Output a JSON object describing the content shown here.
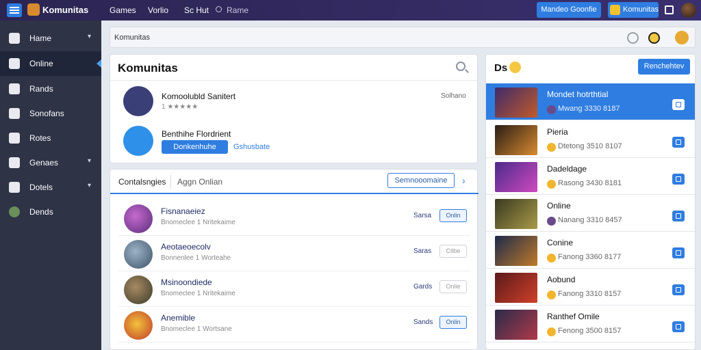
{
  "topbar": {
    "app_title": "Komunitas",
    "nav": [
      "Games",
      "Vorlio",
      "Sc Hut",
      "Rame"
    ],
    "btn_primary": "Mandeo Goonfie",
    "btn_notifications": "Komunitas",
    "icons": [
      "menu-icon",
      "logo-icon",
      "search-icon",
      "notification-icon",
      "grid-icon",
      "user-avatar"
    ]
  },
  "sidebar": {
    "items": [
      {
        "label": "Hame",
        "icon": "home-icon",
        "chevron": true
      },
      {
        "label": "Online",
        "icon": "pen-icon",
        "chevron": false,
        "active": true
      },
      {
        "label": "Rands",
        "icon": "book-icon",
        "chevron": false
      },
      {
        "label": "Sonofans",
        "icon": "chat-icon",
        "chevron": false
      },
      {
        "label": "Rotes",
        "icon": "user-icon",
        "chevron": false
      },
      {
        "label": "Genaes",
        "icon": "pencil-icon",
        "chevron": true
      },
      {
        "label": "Dotels",
        "icon": "building-icon",
        "chevron": true
      },
      {
        "label": "Dends",
        "icon": "avatar-icon",
        "chevron": false
      }
    ]
  },
  "search": {
    "value": "Komunitas"
  },
  "community": {
    "title": "Komunitas",
    "entries": [
      {
        "title": "Komoolubld Sanitert",
        "sub": "1 ★★★★★",
        "right": "Solhano"
      },
      {
        "title": "Benthihe Flordrient",
        "button": "Donkenhuhe",
        "link": "Gshusbate"
      }
    ]
  },
  "categories": {
    "tab1": "Contalsngies",
    "tab2": "Aggn Onlian",
    "button": "Semnooomaine",
    "rows": [
      {
        "title": "Fisnanaeiez",
        "sub": "Bnomeclee 1 Nritekaime",
        "status": "Sarsa",
        "button": "Onlin",
        "online": true
      },
      {
        "title": "Aeotaeoecolv",
        "sub": "Bonnenlee 1 Worteahe",
        "status": "Saras",
        "button": "Ctlbe",
        "online": false
      },
      {
        "title": "Msinoondiede",
        "sub": "Bnomeclee 1 Nritekaime",
        "status": "Gards",
        "button": "Onlie",
        "online": false
      },
      {
        "title": "Anemible",
        "sub": "Bnomeclee 1 Wortsane",
        "status": "Sands",
        "button": "Onlin",
        "online": true
      }
    ]
  },
  "games_panel": {
    "title": "Ds",
    "button": "Renchehtev",
    "games": [
      {
        "name": "Mondet hotrthtial",
        "meta": "Mwang 3330 8187",
        "active": true
      },
      {
        "name": "Pieria",
        "meta": "Dtetong 3510 8107",
        "active": false
      },
      {
        "name": "Dadeldage",
        "meta": "Rasong 3430 8181",
        "active": false
      },
      {
        "name": "Online",
        "meta": "Nanang 3310 8457",
        "active": false
      },
      {
        "name": "Conine",
        "meta": "Fanong 3360 8177",
        "active": false
      },
      {
        "name": "Aobund",
        "meta": "Fanong 3310 8157",
        "active": false
      },
      {
        "name": "Ranthef Omile",
        "meta": "Fenong 3500 8157",
        "active": false
      }
    ]
  },
  "colors": {
    "accent": "#2f7de0",
    "sidebar": "#2e3346",
    "topbar": "#2b2552"
  }
}
